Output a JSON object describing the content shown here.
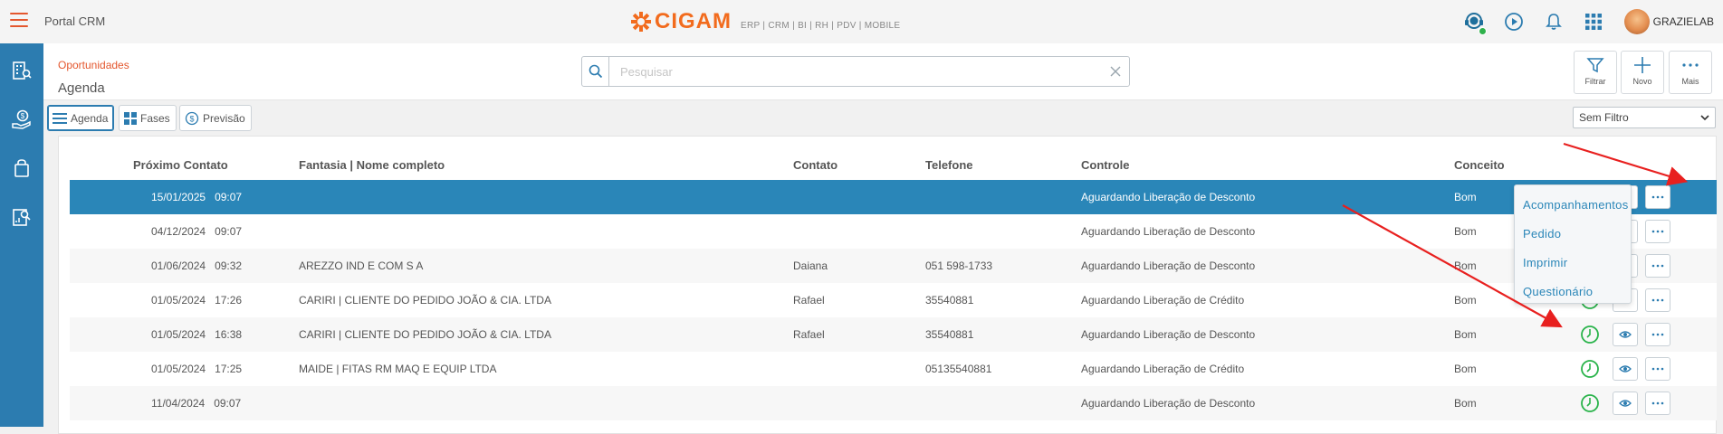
{
  "header": {
    "portal_title": "Portal CRM",
    "logo_text": "CIGAM",
    "logo_subtitle": "ERP | CRM | BI | RH | PDV | MOBILE",
    "username": "GRAZIELAB",
    "brand_color": "#f26b1d",
    "accent_color": "#2c7cb0"
  },
  "sidebar": {
    "items": [
      {
        "icon": "building-search-icon"
      },
      {
        "icon": "money-hand-icon"
      },
      {
        "icon": "shopping-bag-icon"
      },
      {
        "icon": "document-search-icon"
      }
    ]
  },
  "page": {
    "breadcrumb": "Oportunidades",
    "title": "Agenda"
  },
  "search": {
    "placeholder": "Pesquisar",
    "value": ""
  },
  "actions": {
    "filter_label": "Filtrar",
    "new_label": "Novo",
    "more_label": "Mais"
  },
  "view_tabs": [
    {
      "label": "Agenda",
      "active": true
    },
    {
      "label": "Fases",
      "active": false
    },
    {
      "label": "Previsão",
      "active": false
    }
  ],
  "filter_select": {
    "selected": "Sem Filtro"
  },
  "table": {
    "columns": [
      "Próximo Contato",
      "Fantasia | Nome completo",
      "Contato",
      "Telefone",
      "Controle",
      "Conceito"
    ],
    "rows": [
      {
        "date": "15/01/2025",
        "time": "09:07",
        "name": "",
        "contact": "",
        "phone": "",
        "control": "Aguardando Liberação de Desconto",
        "concept": "Bom",
        "selected": true
      },
      {
        "date": "04/12/2024",
        "time": "09:07",
        "name": "",
        "contact": "",
        "phone": "",
        "control": "Aguardando Liberação de Desconto",
        "concept": "Bom",
        "selected": false
      },
      {
        "date": "01/06/2024",
        "time": "09:32",
        "name": "AREZZO IND E COM S A",
        "contact": "Daiana",
        "phone": "051 598-1733",
        "control": "Aguardando Liberação de Desconto",
        "concept": "Bom",
        "selected": false
      },
      {
        "date": "01/05/2024",
        "time": "17:26",
        "name": "CARIRI | CLIENTE DO PEDIDO JOÃO & CIA. LTDA",
        "contact": "Rafael",
        "phone": "35540881",
        "control": "Aguardando Liberação de Crédito",
        "concept": "Bom",
        "selected": false
      },
      {
        "date": "01/05/2024",
        "time": "16:38",
        "name": "CARIRI | CLIENTE DO PEDIDO JOÃO & CIA. LTDA",
        "contact": "Rafael",
        "phone": "35540881",
        "control": "Aguardando Liberação de Desconto",
        "concept": "Bom",
        "selected": false
      },
      {
        "date": "01/05/2024",
        "time": "17:25",
        "name": "MAIDE | FITAS RM MAQ E EQUIP LTDA",
        "contact": "",
        "phone": "05135540881",
        "control": "Aguardando Liberação de Crédito",
        "concept": "Bom",
        "selected": false
      },
      {
        "date": "11/04/2024",
        "time": "09:07",
        "name": "",
        "contact": "",
        "phone": "",
        "control": "Aguardando Liberação de Desconto",
        "concept": "Bom",
        "selected": false
      }
    ]
  },
  "dropdown_menu": {
    "items": [
      "Acompanhamentos",
      "Pedido",
      "Imprimir",
      "Questionário"
    ]
  },
  "annotation_color": "#e8201f"
}
